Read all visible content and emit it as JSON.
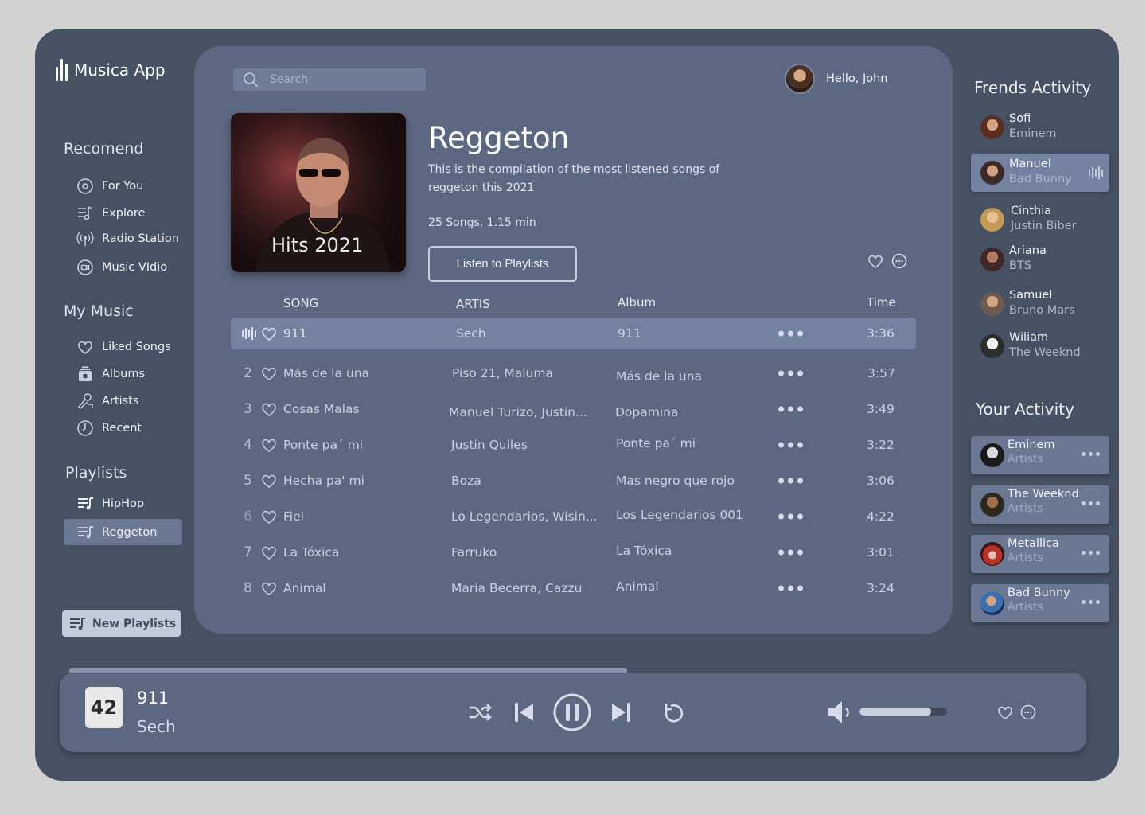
{
  "app": {
    "name": "Musica App"
  },
  "sidebar": {
    "recommend_title": "Recomend",
    "recommend": [
      {
        "label": "For You",
        "icon": "disc-icon"
      },
      {
        "label": "Explore",
        "icon": "explore-icon"
      },
      {
        "label": "Radio Station",
        "icon": "radio-icon"
      },
      {
        "label": "Music VIdio",
        "icon": "video-icon"
      }
    ],
    "mymusic_title": "My Music",
    "mymusic": [
      {
        "label": "Liked Songs",
        "icon": "heart-icon"
      },
      {
        "label": "Albums",
        "icon": "album-icon"
      },
      {
        "label": "Artists",
        "icon": "artist-icon"
      },
      {
        "label": "Recent",
        "icon": "clock-icon"
      }
    ],
    "playlists_title": "Playlists",
    "playlists": [
      {
        "label": "HipHop",
        "icon": "playlist-icon"
      },
      {
        "label": "Reggeton",
        "icon": "playlist-icon",
        "active": true
      }
    ],
    "new_playlist": "New Playlists"
  },
  "header": {
    "search_placeholder": "Search",
    "greeting": "Hello, John"
  },
  "playlist": {
    "cover_text": "Hits 2021",
    "title": "Reggeton",
    "description": "This is the compilation of the most listened songs of reggeton this 2021",
    "meta": "25 Songs, 1.15 min",
    "listen_button": "Listen to Playlists"
  },
  "table": {
    "headers": {
      "song": "SONG",
      "artist": "ARTIS",
      "album": "Album",
      "time": "Time"
    },
    "rows": [
      {
        "num": "",
        "song": "911",
        "artist": "Sech",
        "album": "911",
        "time": "3:36",
        "playing": true
      },
      {
        "num": "2",
        "song": "Más de la una",
        "artist": "Piso 21, Maluma",
        "album": "Más de la una",
        "time": "3:57"
      },
      {
        "num": "3",
        "song": "Cosas Malas",
        "artist": "Manuel Turizo, Justin...",
        "album": "Dopamina",
        "time": "3:49"
      },
      {
        "num": "4",
        "song": "Ponte pa´ mi",
        "artist": "Justin Quiles",
        "album": "Ponte pa´ mi",
        "time": "3:22"
      },
      {
        "num": "5",
        "song": "Hecha pa' mi",
        "artist": "Boza",
        "album": "Mas negro que rojo",
        "time": "3:06"
      },
      {
        "num": "6",
        "song": "Fiel",
        "artist": "Lo Legendarios, Wisin...",
        "album": "Los Legendarios 001",
        "time": "4:22"
      },
      {
        "num": "7",
        "song": "La Tóxica",
        "artist": "Farruko",
        "album": "La Tóxica",
        "time": "3:01"
      },
      {
        "num": "8",
        "song": "Animal",
        "artist": "Maria Becerra,  Cazzu",
        "album": "Animal",
        "time": "3:24"
      }
    ]
  },
  "friends": {
    "title": "Frends Activity",
    "items": [
      {
        "name": "Sofi",
        "listening": "Eminem"
      },
      {
        "name": "Manuel",
        "listening": "Bad Bunny",
        "active": true
      },
      {
        "name": "Cinthia",
        "listening": "Justin Biber"
      },
      {
        "name": "Ariana",
        "listening": "BTS"
      },
      {
        "name": "Samuel",
        "listening": "Bruno Mars"
      },
      {
        "name": "Wiliam",
        "listening": "The Weeknd"
      }
    ]
  },
  "your_activity": {
    "title": "Your Activity",
    "items": [
      {
        "name": "Eminem",
        "type": "Artists"
      },
      {
        "name": "The Weeknd",
        "type": "Artists"
      },
      {
        "name": "Metallica",
        "type": "Artists"
      },
      {
        "name": "Bad Bunny",
        "type": "Artists"
      }
    ]
  },
  "player": {
    "cover_text": "42",
    "title": "911",
    "artist": "Sech",
    "progress": 0.55,
    "volume": 0.82
  },
  "colors": {
    "background": "#d2d2d2",
    "app": "#465163",
    "panel": "#5c6881",
    "active_row": "#7382a0"
  }
}
